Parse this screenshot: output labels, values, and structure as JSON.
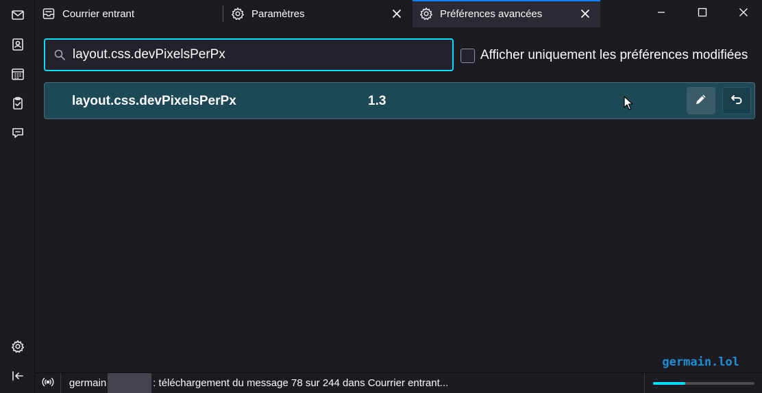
{
  "tabs": [
    {
      "label": "Courrier entrant",
      "icon": "inbox-icon"
    },
    {
      "label": "Paramètres",
      "icon": "gear-icon"
    },
    {
      "label": "Préférences avancées",
      "icon": "gear-icon"
    }
  ],
  "search": {
    "value": "layout.css.devPixelsPerPx"
  },
  "filter": {
    "modified_only_label": "Afficher uniquement les préférences modifiées",
    "checked": false
  },
  "preferences": [
    {
      "name": "layout.css.devPixelsPerPx",
      "value": "1.3"
    }
  ],
  "watermark": "germain.lol",
  "status": {
    "prefix": "germain",
    "message": ": téléchargement du message 78 sur 244 dans Courrier entrant...",
    "progress": 0.32
  },
  "colors": {
    "accent": "#00ddff",
    "tab_indicator": "#0a84ff",
    "row_highlight": "#1d4856"
  }
}
